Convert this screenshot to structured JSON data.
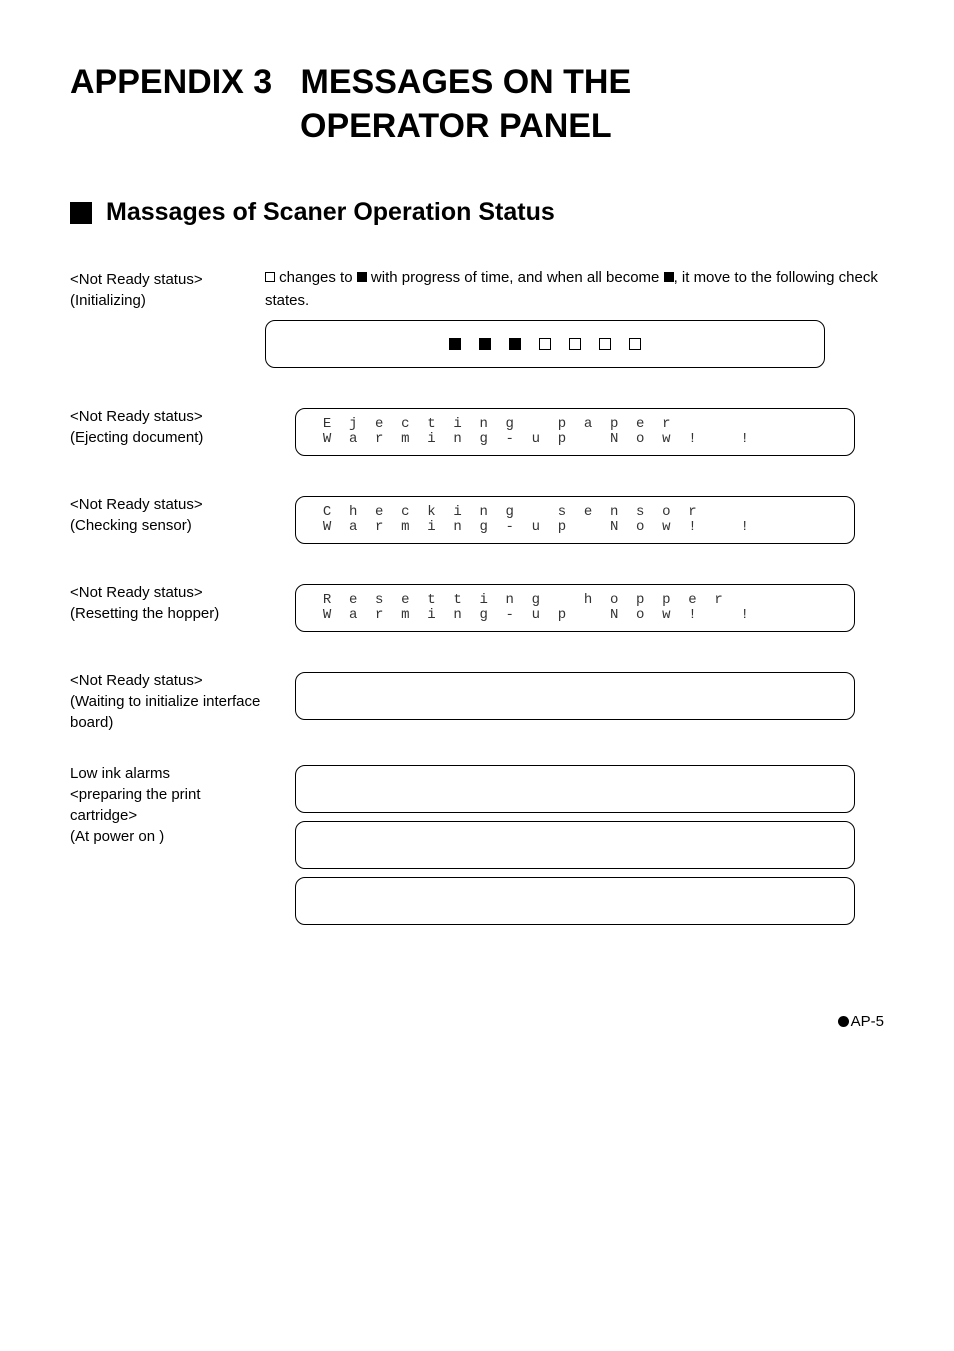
{
  "title_line1": "APPENDIX 3",
  "title_line2": "MESSAGES ON THE",
  "title_line3": "OPERATOR PANEL",
  "section_heading": "Massages of Scaner Operation Status",
  "init": {
    "label1": "<Not Ready status>",
    "label2": "(Initializing)",
    "desc_a": "changes to",
    "desc_b": "with progress of time, and when all become",
    "desc_c": ", it move to the following check states."
  },
  "eject": {
    "label1": "<Not Ready status>",
    "label2": "(Ejecting document)",
    "lcd_row1": [
      "E",
      "j",
      "e",
      "c",
      "t",
      "i",
      "n",
      "g",
      "",
      "p",
      "a",
      "p",
      "e",
      "r",
      "",
      "",
      "",
      "",
      "",
      ""
    ],
    "lcd_row2": [
      "W",
      "a",
      "r",
      "m",
      "i",
      "n",
      "g",
      "-",
      "u",
      "p",
      "",
      "N",
      "o",
      "w",
      "!",
      "",
      "!",
      "",
      "",
      ""
    ]
  },
  "check": {
    "label1": "<Not Ready status>",
    "label2": "(Checking sensor)",
    "lcd_row1": [
      "C",
      "h",
      "e",
      "c",
      "k",
      "i",
      "n",
      "g",
      "",
      "s",
      "e",
      "n",
      "s",
      "o",
      "r",
      "",
      "",
      "",
      "",
      ""
    ],
    "lcd_row2": [
      "W",
      "a",
      "r",
      "m",
      "i",
      "n",
      "g",
      "-",
      "u",
      "p",
      "",
      "N",
      "o",
      "w",
      "!",
      "",
      "!",
      "",
      "",
      ""
    ]
  },
  "reset": {
    "label1": "<Not Ready status>",
    "label2": "(Resetting the hopper)",
    "lcd_row1": [
      "R",
      "e",
      "s",
      "e",
      "t",
      "t",
      "i",
      "n",
      "g",
      "",
      "h",
      "o",
      "p",
      "p",
      "e",
      "r",
      "",
      "",
      "",
      ""
    ],
    "lcd_row2": [
      "W",
      "a",
      "r",
      "m",
      "i",
      "n",
      "g",
      "-",
      "u",
      "p",
      "",
      "N",
      "o",
      "w",
      "!",
      "",
      "!",
      "",
      "",
      ""
    ]
  },
  "wait": {
    "label1": "<Not Ready status>",
    "label2": "(Waiting to initialize interface board)"
  },
  "lowink": {
    "label1": "Low ink alarms",
    "label2": "<preparing the print cartridge>",
    "label3": "(At power on )"
  },
  "footer": "AP-5"
}
